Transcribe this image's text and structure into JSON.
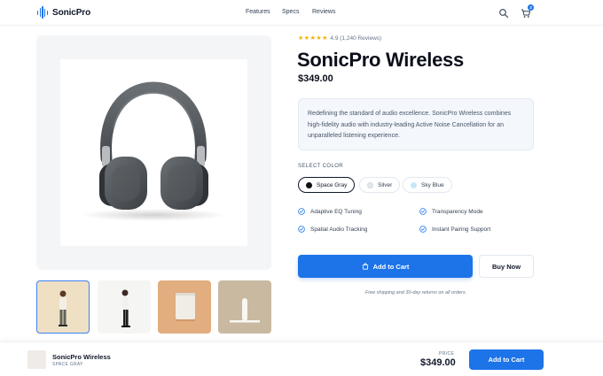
{
  "header": {
    "brand": "SonicPro",
    "nav": [
      "Features",
      "Specs",
      "Reviews"
    ],
    "cart_count": "3"
  },
  "product": {
    "rating_value": 4.9,
    "rating_text": "4.9 (1,240 Reviews)",
    "name": "SonicPro Wireless",
    "price": "$349.00",
    "description": "Redefining the standard of audio excellence. SonicPro Wireless combines high-fidelity audio with industry-leading Active Noise Cancellation for an unparalleled listening experience.",
    "select_color_label": "SELECT COLOR",
    "colors": [
      {
        "name": "Space Gray",
        "hex": "#111111",
        "selected": true
      },
      {
        "name": "Silver",
        "hex": "#e5e7eb",
        "selected": false
      },
      {
        "name": "Sky Blue",
        "hex": "#c7e7f8",
        "selected": false
      }
    ],
    "features": [
      "Adaptive EQ Tuning",
      "Transparency Mode",
      "Spatial Audio Tracking",
      "Instant Pairing Support"
    ],
    "add_to_cart": "Add to Cart",
    "buy_now": "Buy Now",
    "shipping_note": "Free shipping and 30-day returns on all orders."
  },
  "gallery": {
    "thumbnails": [
      "model-front",
      "model-side",
      "charging-case",
      "headphone-stand"
    ],
    "active_index": 0
  },
  "sticky_bar": {
    "name": "SonicPro Wireless",
    "variant": "SPACE GRAY",
    "price_label": "PRICE",
    "price": "$349.00",
    "button": "Add to Cart"
  },
  "colors": {
    "accent": "#1d74e8",
    "star": "#f5b301",
    "text": "#0f172a"
  }
}
